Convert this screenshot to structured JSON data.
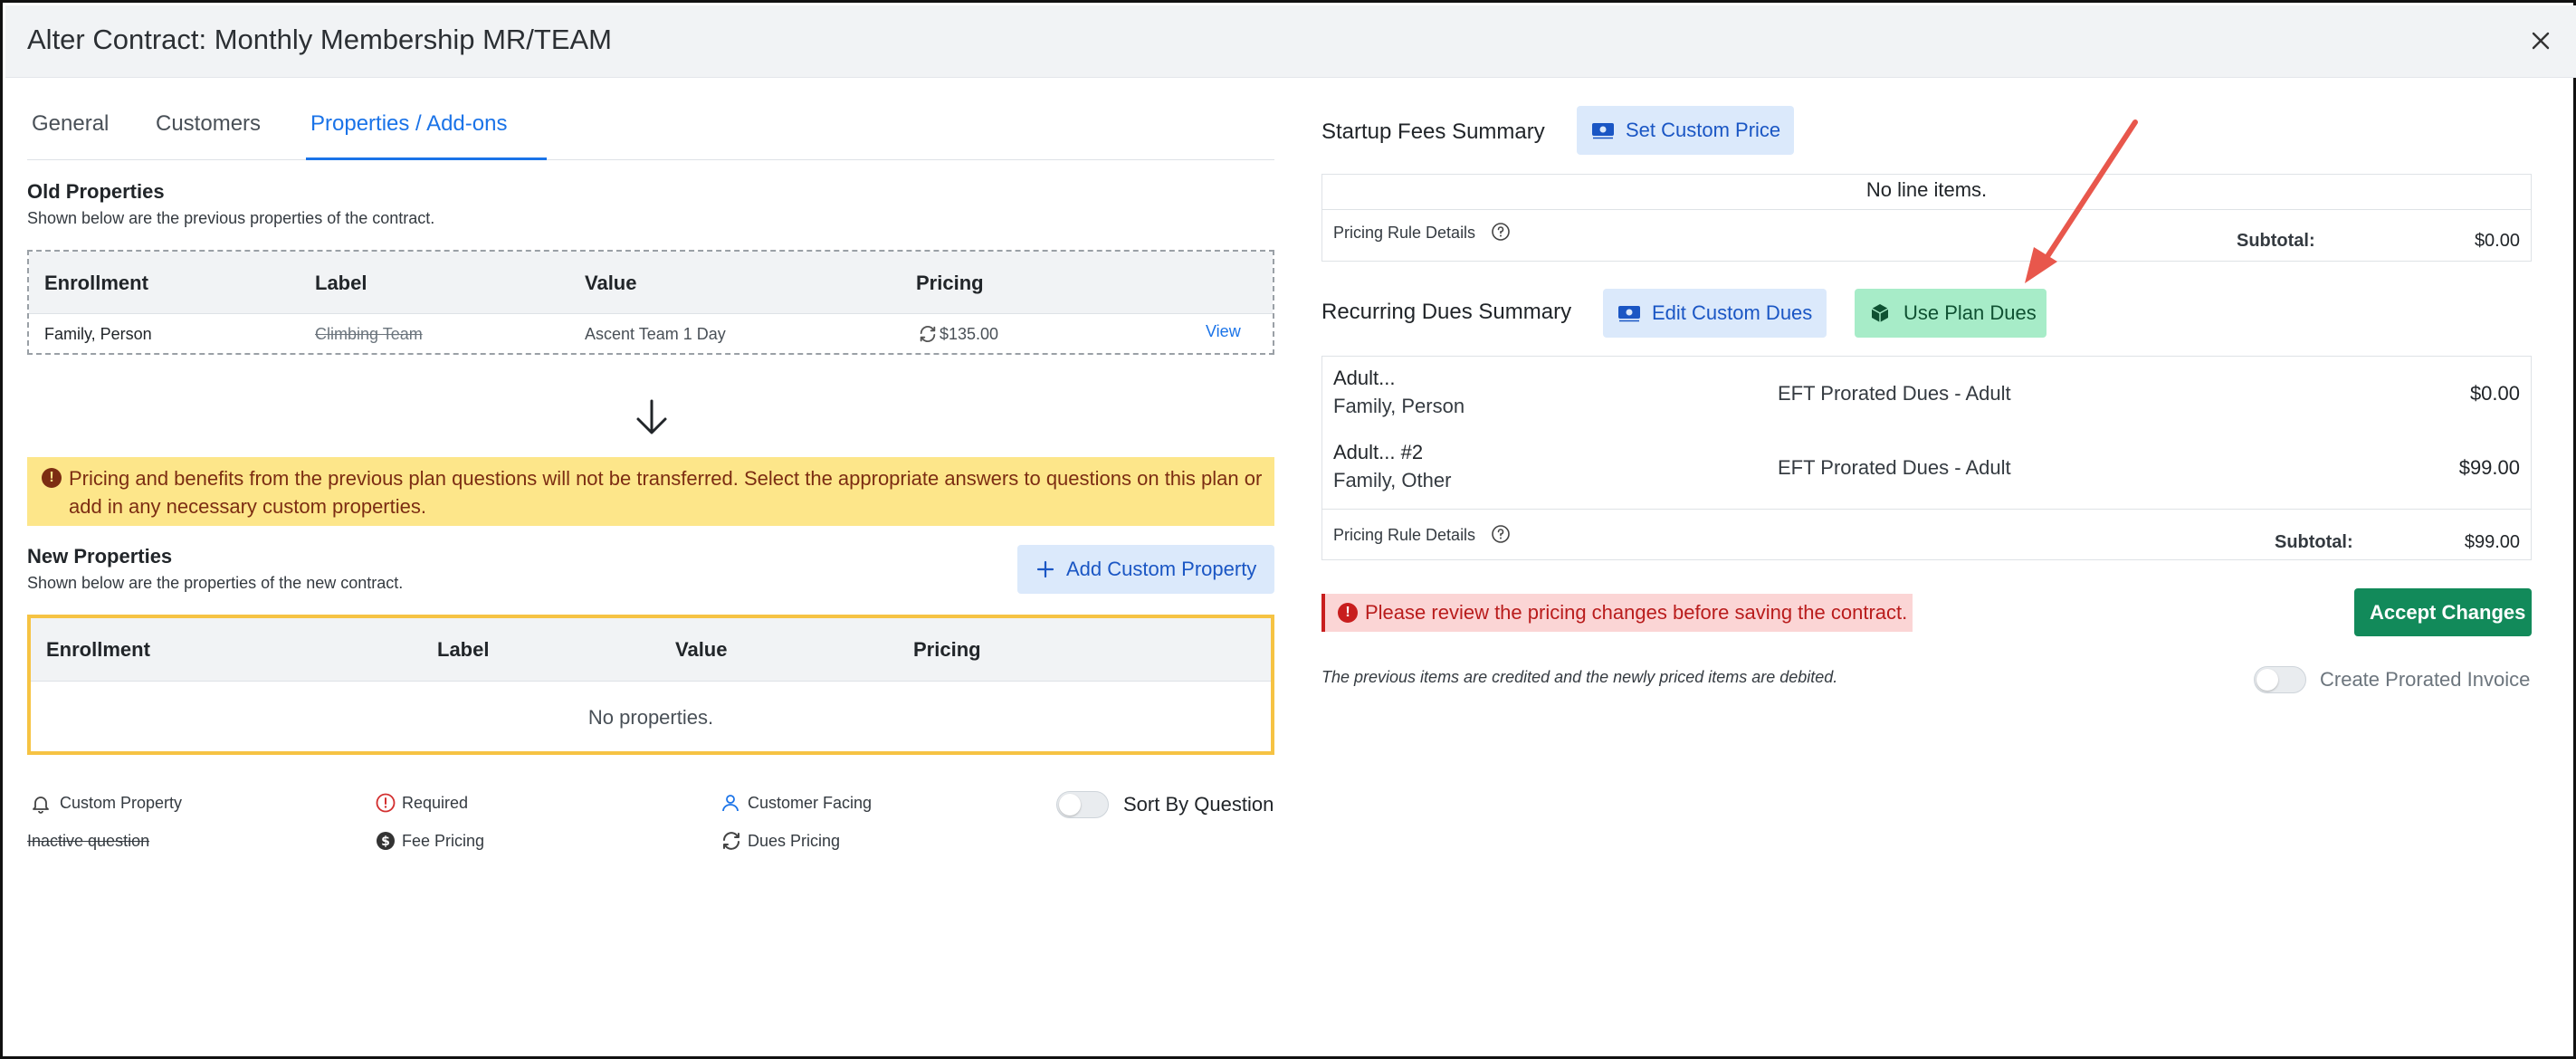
{
  "modal": {
    "title": "Alter Contract: Monthly Membership MR/TEAM"
  },
  "tabs": [
    {
      "label": "General"
    },
    {
      "label": "Customers"
    },
    {
      "label": "Properties / Add-ons"
    }
  ],
  "old_properties": {
    "title": "Old Properties",
    "subtitle": "Shown below are the previous properties of the contract.",
    "columns": [
      "Enrollment",
      "Label",
      "Value",
      "Pricing"
    ],
    "rows": [
      {
        "enrollment": "Family, Person",
        "label": "Climbing Team",
        "value": "Ascent Team 1 Day",
        "pricing": "$135.00",
        "action": "View"
      }
    ]
  },
  "warning": {
    "text": "Pricing and benefits from the previous plan questions will not be transferred. Select the appropriate answers to questions on this plan or add in any necessary custom properties."
  },
  "new_properties": {
    "title": "New Properties",
    "subtitle": "Shown below are the properties of the new contract.",
    "add_button": "Add Custom Property",
    "columns": [
      "Enrollment",
      "Label",
      "Value",
      "Pricing"
    ],
    "empty_text": "No properties."
  },
  "legend": {
    "custom_property": "Custom Property",
    "inactive_question": "Inactive question",
    "required": "Required",
    "fee_pricing": "Fee Pricing",
    "customer_facing": "Customer Facing",
    "dues_pricing": "Dues Pricing",
    "sort_toggle_label": "Sort By Question"
  },
  "startup_fees": {
    "title": "Startup Fees Summary",
    "button": "Set Custom Price",
    "empty_text": "No line items.",
    "pricing_rule_label": "Pricing Rule Details",
    "subtotal_label": "Subtotal:",
    "subtotal_value": "$0.00"
  },
  "recurring_dues": {
    "title": "Recurring Dues Summary",
    "edit_button": "Edit Custom Dues",
    "plan_button": "Use Plan Dues",
    "items": [
      {
        "name": "Adult...",
        "customer": "Family, Person",
        "description": "EFT Prorated Dues - Adult",
        "amount": "$0.00"
      },
      {
        "name": "Adult... #2",
        "customer": "Family, Other",
        "description": "EFT Prorated Dues - Adult",
        "amount": "$99.00"
      }
    ],
    "pricing_rule_label": "Pricing Rule Details",
    "subtotal_label": "Subtotal:",
    "subtotal_value": "$99.00"
  },
  "error": {
    "text": "Please review the pricing changes before saving the contract."
  },
  "accept_button": "Accept Changes",
  "footer": {
    "note": "The previous items are credited and the newly priced items are debited.",
    "prorated_toggle_label": "Create Prorated Invoice"
  },
  "colors": {
    "accent": "#1a73e8",
    "warning_bg": "#fde68a",
    "warning_text": "#7c2d12",
    "error_text": "#b91c1c",
    "success": "#128a5a",
    "highlight_border": "#f6c343",
    "annotation_arrow": "#e8574c"
  },
  "icons": [
    "close-icon",
    "refresh-icon",
    "arrow-down-icon",
    "exclamation-icon",
    "plus-icon",
    "bell-icon",
    "dollar-circle-icon",
    "user-icon",
    "cash-icon",
    "box-icon",
    "question-circle-icon"
  ]
}
